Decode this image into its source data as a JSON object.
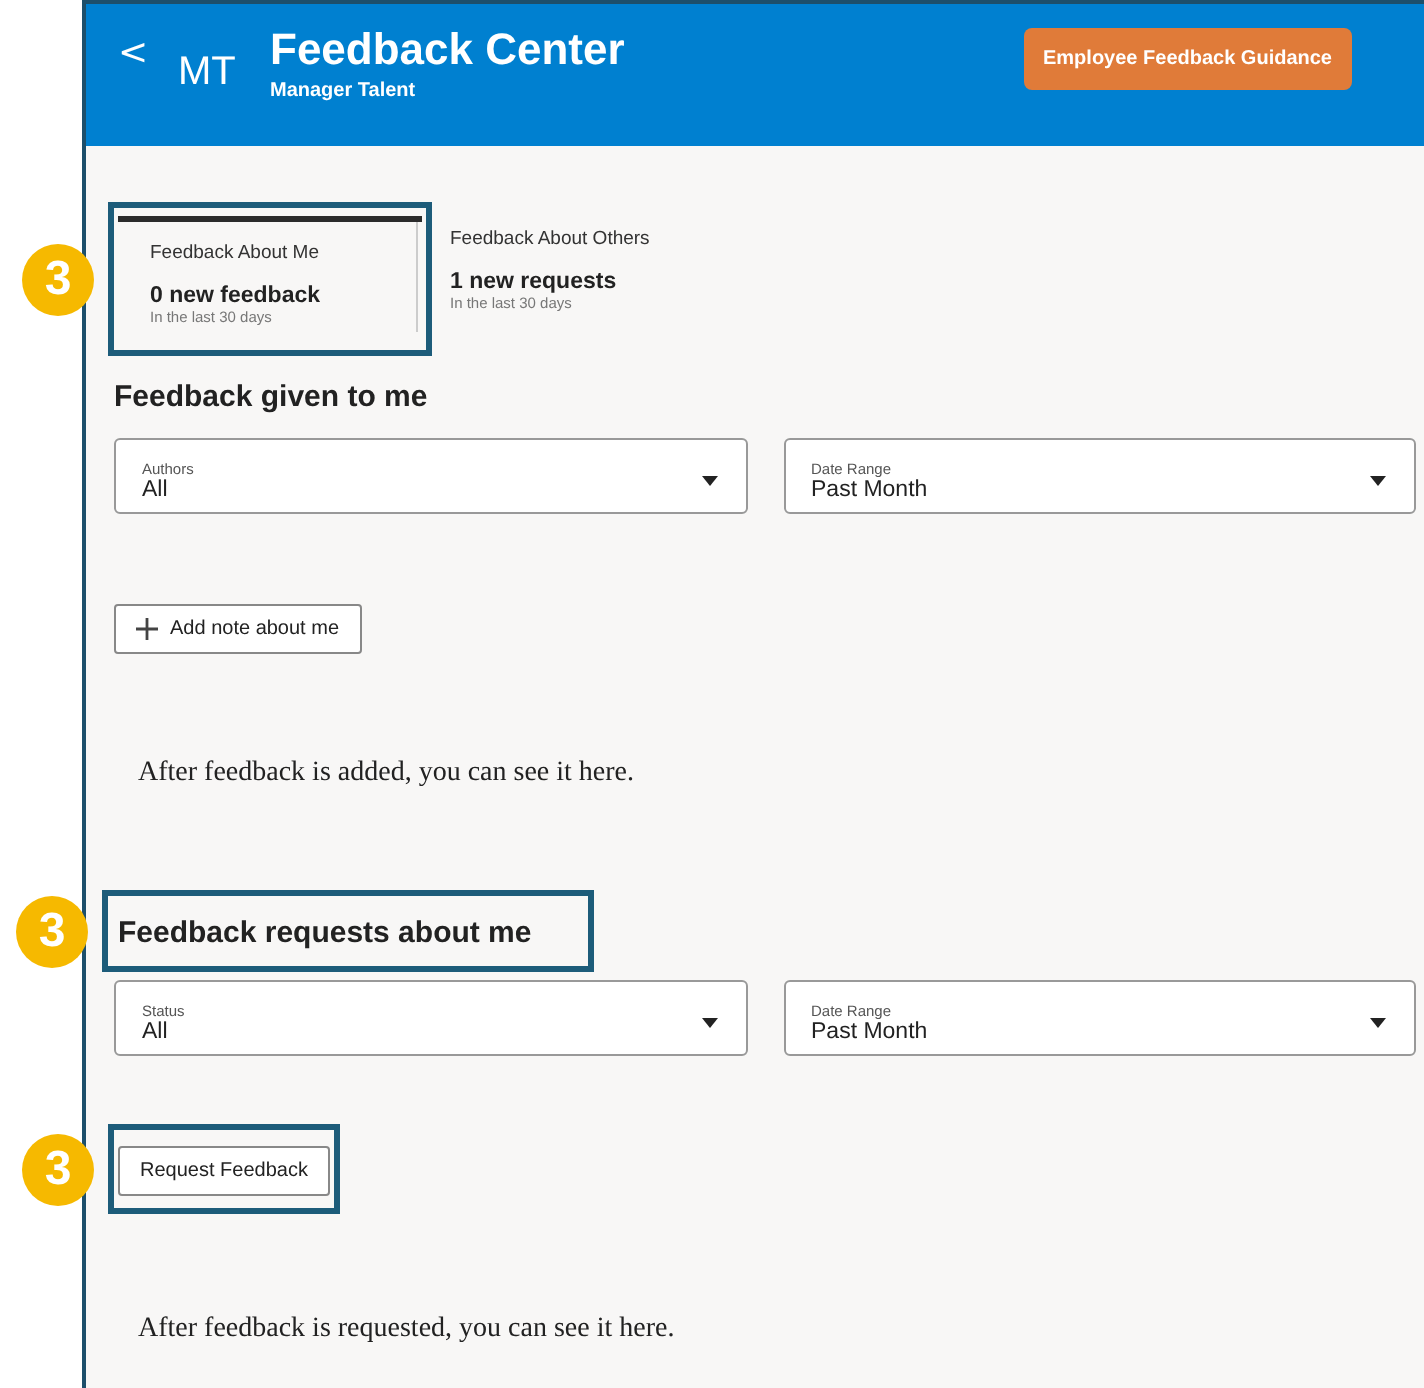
{
  "header": {
    "back": "<",
    "initials": "MT",
    "title": "Feedback Center",
    "subtitle": "Manager Talent",
    "action": "Employee Feedback Guidance"
  },
  "tabs": [
    {
      "label": "Feedback About Me",
      "count": "0 new feedback",
      "period": "In the last 30 days",
      "selected": true,
      "callout": "3"
    },
    {
      "label": "Feedback About Others",
      "count": "1 new requests",
      "period": "In the last 30 days",
      "selected": false
    }
  ],
  "sections": [
    {
      "heading": "Feedback given to me",
      "filters": [
        {
          "label": "Authors",
          "value": "All"
        },
        {
          "label": "Date Range",
          "value": "Past Month"
        }
      ],
      "button": {
        "label": "Add note about me",
        "kind": "add"
      },
      "empty_message": "After feedback is added, you can see it here."
    },
    {
      "heading": "Feedback requests about me",
      "heading_callout": "3",
      "filters": [
        {
          "label": "Status",
          "value": "All"
        },
        {
          "label": "Date Range",
          "value": "Past Month"
        }
      ],
      "button": {
        "label": "Request Feedback",
        "kind": "plain",
        "callout": "3"
      },
      "empty_message": "After feedback is requested, you can see it here."
    }
  ]
}
